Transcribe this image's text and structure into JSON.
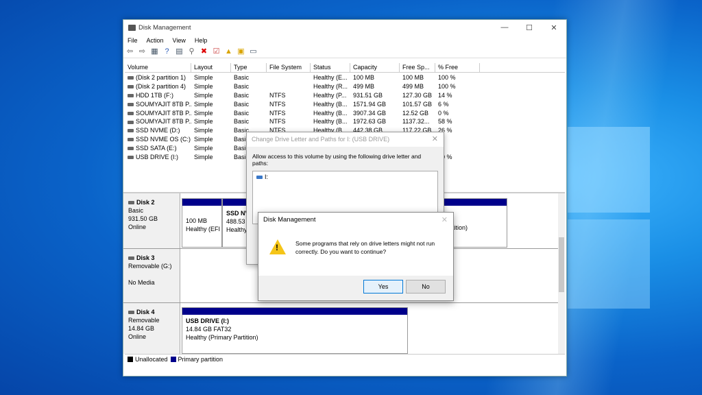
{
  "window": {
    "title": "Disk Management",
    "min": "—",
    "max": "☐",
    "close": "✕"
  },
  "menu": [
    "File",
    "Action",
    "View",
    "Help"
  ],
  "columns": [
    "Volume",
    "Layout",
    "Type",
    "File System",
    "Status",
    "Capacity",
    "Free Sp...",
    "% Free"
  ],
  "volumes": [
    [
      "(Disk 2 partition 1)",
      "Simple",
      "Basic",
      "",
      "Healthy (E...",
      "100 MB",
      "100 MB",
      "100 %"
    ],
    [
      "(Disk 2 partition 4)",
      "Simple",
      "Basic",
      "",
      "Healthy (R...",
      "499 MB",
      "499 MB",
      "100 %"
    ],
    [
      "HDD 1TB (F:)",
      "Simple",
      "Basic",
      "NTFS",
      "Healthy (P...",
      "931.51 GB",
      "127.30 GB",
      "14 %"
    ],
    [
      "SOUMYAJIT 8TB P...",
      "Simple",
      "Basic",
      "NTFS",
      "Healthy (B...",
      "1571.94 GB",
      "101.57 GB",
      "6 %"
    ],
    [
      "SOUMYAJIT 8TB P...",
      "Simple",
      "Basic",
      "NTFS",
      "Healthy (B...",
      "3907.34 GB",
      "12.52 GB",
      "0 %"
    ],
    [
      "SOUMYAJIT 8TB P...",
      "Simple",
      "Basic",
      "NTFS",
      "Healthy (B...",
      "1972.63 GB",
      "1137.32...",
      "58 %"
    ],
    [
      "SSD NVME (D:)",
      "Simple",
      "Basic",
      "NTFS",
      "Healthy (B...",
      "442.38 GB",
      "117.22 GB",
      "26 %"
    ],
    [
      "SSD NVME OS (C:)",
      "Simple",
      "Basic",
      "",
      "",
      "",
      "",
      "%"
    ],
    [
      "SSD SATA (E:)",
      "Simple",
      "Basic",
      "",
      "",
      "",
      "",
      "%"
    ],
    [
      "USB DRIVE (I:)",
      "Simple",
      "Basic",
      "",
      "",
      "",
      "",
      "00 %"
    ]
  ],
  "disks": {
    "d2": {
      "name": "Disk 2",
      "l1": "Basic",
      "l2": "931.50 GB",
      "l3": "Online",
      "p1a": "100 MB",
      "p1b": "Healthy (EFI",
      "p2a": "SSD NV",
      "p2b": "488.53 G",
      "p2c": "Healthy",
      "p3": "artition)"
    },
    "d3": {
      "name": "Disk 3",
      "l1": "Removable (G:)",
      "l3": "No Media"
    },
    "d4": {
      "name": "Disk 4",
      "l1": "Removable",
      "l2": "14.84 GB",
      "l3": "Online",
      "pa": "USB DRIVE  (I:)",
      "pb": "14.84 GB FAT32",
      "pc": "Healthy (Primary Partition)"
    }
  },
  "legend": {
    "unalloc": "Unallocated",
    "primary": "Primary partition",
    "unalloc_color": "#000000",
    "primary_color": "#00008b"
  },
  "dialog1": {
    "title": "Change Drive Letter and Paths for I: (USB DRIVE)",
    "msg": "Allow access to this volume by using the following drive letter and paths:",
    "item": "I:",
    "close": "✕"
  },
  "dialog2": {
    "title": "Disk Management",
    "close": "✕",
    "message": "Some programs that rely on drive letters might not run correctly. Do you want to continue?",
    "yes": "Yes",
    "no": "No"
  }
}
